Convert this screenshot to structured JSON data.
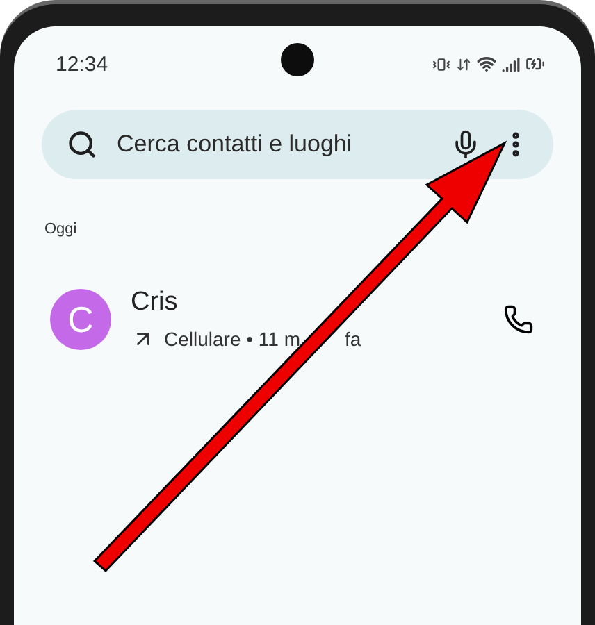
{
  "status_bar": {
    "time": "12:34"
  },
  "search": {
    "placeholder": "Cerca contatti e luoghi"
  },
  "section": "Oggi",
  "calls": [
    {
      "initial": "C",
      "name": "Cris",
      "detail": [
        "Cellulare • 11 m",
        "fa"
      ],
      "color": "#c46ae8"
    }
  ]
}
